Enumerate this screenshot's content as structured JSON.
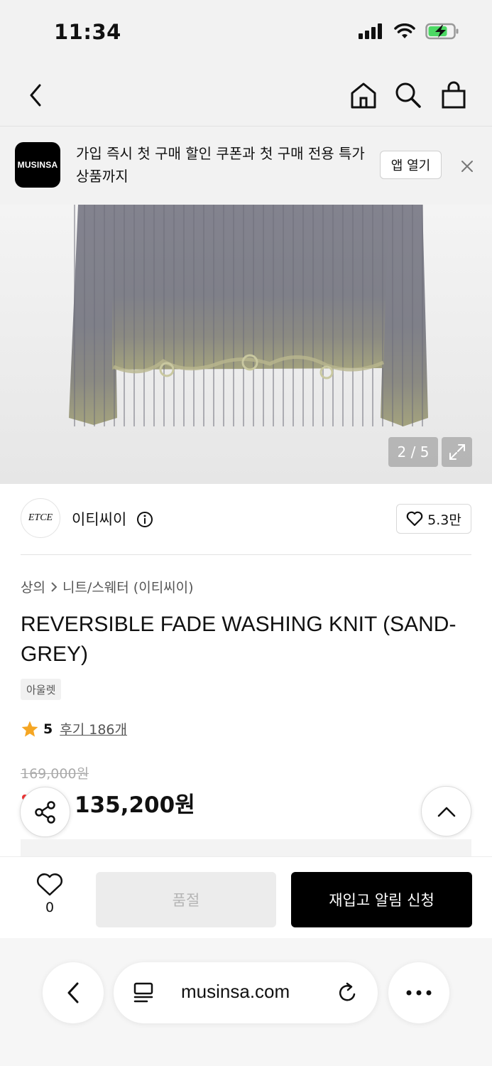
{
  "status_bar": {
    "time": "11:34"
  },
  "banner": {
    "logo_text": "MUSINSA",
    "message": "가입 즉시 첫 구매 할인 쿠폰과 첫 구매 전용 특가 상품까지",
    "open_app_label": "앱 열기"
  },
  "gallery": {
    "counter": "2 / 5"
  },
  "brand": {
    "logo_text": "ETCE",
    "name": "이티씨이",
    "likes": "5.3만"
  },
  "product": {
    "breadcrumb": [
      "상의",
      "니트/스웨터 (이티씨이)"
    ],
    "title": "REVERSIBLE FADE WASHING KNIT (SAND-GREY)",
    "badge": "아울렛",
    "rating": "5",
    "reviews": "후기 186개",
    "original_price": "169,000원",
    "sale_price": "135,200원"
  },
  "purchase_bar": {
    "wish_count": "0",
    "soldout_label": "품절",
    "restock_label": "재입고 알림 신청"
  },
  "browser": {
    "url": "musinsa.com"
  },
  "colors": {
    "accent": "#000000",
    "star": "#f5a623",
    "sale_red": "#e33333"
  }
}
